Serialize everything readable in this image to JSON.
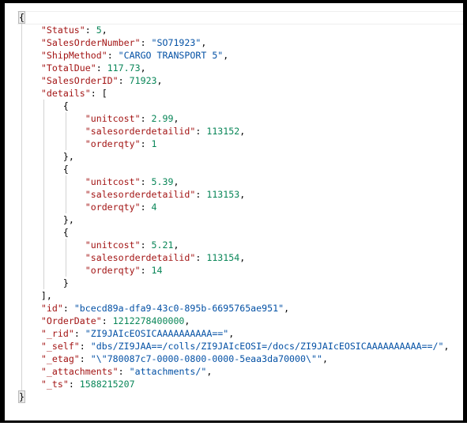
{
  "editor": {
    "colors": {
      "key": "#a31515",
      "string": "#0451a5",
      "number": "#098658"
    },
    "lines": [
      {
        "indent": 0,
        "tokens": [
          [
            "p",
            "{"
          ]
        ],
        "brace": true
      },
      {
        "indent": 1,
        "tokens": [
          [
            "key",
            "\"Status\""
          ],
          [
            "p",
            ": "
          ],
          [
            "num",
            "5"
          ],
          [
            "p",
            ","
          ]
        ]
      },
      {
        "indent": 1,
        "tokens": [
          [
            "key",
            "\"SalesOrderNumber\""
          ],
          [
            "p",
            ": "
          ],
          [
            "str",
            "\"SO71923\""
          ],
          [
            "p",
            ","
          ]
        ]
      },
      {
        "indent": 1,
        "tokens": [
          [
            "key",
            "\"ShipMethod\""
          ],
          [
            "p",
            ": "
          ],
          [
            "str",
            "\"CARGO TRANSPORT 5\""
          ],
          [
            "p",
            ","
          ]
        ]
      },
      {
        "indent": 1,
        "tokens": [
          [
            "key",
            "\"TotalDue\""
          ],
          [
            "p",
            ": "
          ],
          [
            "num",
            "117.73"
          ],
          [
            "p",
            ","
          ]
        ]
      },
      {
        "indent": 1,
        "tokens": [
          [
            "key",
            "\"SalesOrderID\""
          ],
          [
            "p",
            ": "
          ],
          [
            "num",
            "71923"
          ],
          [
            "p",
            ","
          ]
        ]
      },
      {
        "indent": 1,
        "tokens": [
          [
            "key",
            "\"details\""
          ],
          [
            "p",
            ": ["
          ]
        ]
      },
      {
        "indent": 2,
        "tokens": [
          [
            "p",
            "{"
          ]
        ]
      },
      {
        "indent": 3,
        "tokens": [
          [
            "key",
            "\"unitcost\""
          ],
          [
            "p",
            ": "
          ],
          [
            "num",
            "2.99"
          ],
          [
            "p",
            ","
          ]
        ]
      },
      {
        "indent": 3,
        "tokens": [
          [
            "key",
            "\"salesorderdetailid\""
          ],
          [
            "p",
            ": "
          ],
          [
            "num",
            "113152"
          ],
          [
            "p",
            ","
          ]
        ]
      },
      {
        "indent": 3,
        "tokens": [
          [
            "key",
            "\"orderqty\""
          ],
          [
            "p",
            ": "
          ],
          [
            "num",
            "1"
          ]
        ]
      },
      {
        "indent": 2,
        "tokens": [
          [
            "p",
            "},"
          ]
        ]
      },
      {
        "indent": 2,
        "tokens": [
          [
            "p",
            "{"
          ]
        ]
      },
      {
        "indent": 3,
        "tokens": [
          [
            "key",
            "\"unitcost\""
          ],
          [
            "p",
            ": "
          ],
          [
            "num",
            "5.39"
          ],
          [
            "p",
            ","
          ]
        ]
      },
      {
        "indent": 3,
        "tokens": [
          [
            "key",
            "\"salesorderdetailid\""
          ],
          [
            "p",
            ": "
          ],
          [
            "num",
            "113153"
          ],
          [
            "p",
            ","
          ]
        ]
      },
      {
        "indent": 3,
        "tokens": [
          [
            "key",
            "\"orderqty\""
          ],
          [
            "p",
            ": "
          ],
          [
            "num",
            "4"
          ]
        ]
      },
      {
        "indent": 2,
        "tokens": [
          [
            "p",
            "},"
          ]
        ]
      },
      {
        "indent": 2,
        "tokens": [
          [
            "p",
            "{"
          ]
        ]
      },
      {
        "indent": 3,
        "tokens": [
          [
            "key",
            "\"unitcost\""
          ],
          [
            "p",
            ": "
          ],
          [
            "num",
            "5.21"
          ],
          [
            "p",
            ","
          ]
        ]
      },
      {
        "indent": 3,
        "tokens": [
          [
            "key",
            "\"salesorderdetailid\""
          ],
          [
            "p",
            ": "
          ],
          [
            "num",
            "113154"
          ],
          [
            "p",
            ","
          ]
        ]
      },
      {
        "indent": 3,
        "tokens": [
          [
            "key",
            "\"orderqty\""
          ],
          [
            "p",
            ": "
          ],
          [
            "num",
            "14"
          ]
        ]
      },
      {
        "indent": 2,
        "tokens": [
          [
            "p",
            "}"
          ]
        ]
      },
      {
        "indent": 1,
        "tokens": [
          [
            "p",
            "],"
          ]
        ]
      },
      {
        "indent": 1,
        "tokens": [
          [
            "key",
            "\"id\""
          ],
          [
            "p",
            ": "
          ],
          [
            "str",
            "\"bcecd89a-dfa9-43c0-895b-6695765ae951\""
          ],
          [
            "p",
            ","
          ]
        ]
      },
      {
        "indent": 1,
        "tokens": [
          [
            "key",
            "\"OrderDate\""
          ],
          [
            "p",
            ": "
          ],
          [
            "num",
            "1212278400000"
          ],
          [
            "p",
            ","
          ]
        ]
      },
      {
        "indent": 1,
        "tokens": [
          [
            "key",
            "\"_rid\""
          ],
          [
            "p",
            ": "
          ],
          [
            "str",
            "\"ZI9JAIcEOSICAAAAAAAAAA==\""
          ],
          [
            "p",
            ","
          ]
        ]
      },
      {
        "indent": 1,
        "tokens": [
          [
            "key",
            "\"_self\""
          ],
          [
            "p",
            ": "
          ],
          [
            "str",
            "\"dbs/ZI9JAA==/colls/ZI9JAIcEOSI=/docs/ZI9JAIcEOSICAAAAAAAAAA==/\""
          ],
          [
            "p",
            ","
          ]
        ]
      },
      {
        "indent": 1,
        "tokens": [
          [
            "key",
            "\"_etag\""
          ],
          [
            "p",
            ": "
          ],
          [
            "str",
            "\"\\\"780087c7-0000-0800-0000-5eaa3da70000\\\"\""
          ],
          [
            "p",
            ","
          ]
        ]
      },
      {
        "indent": 1,
        "tokens": [
          [
            "key",
            "\"_attachments\""
          ],
          [
            "p",
            ": "
          ],
          [
            "str",
            "\"attachments/\""
          ],
          [
            "p",
            ","
          ]
        ]
      },
      {
        "indent": 1,
        "tokens": [
          [
            "key",
            "\"_ts\""
          ],
          [
            "p",
            ": "
          ],
          [
            "num",
            "1588215207"
          ]
        ]
      },
      {
        "indent": 0,
        "tokens": [
          [
            "p",
            "}"
          ]
        ],
        "brace": true
      }
    ]
  }
}
